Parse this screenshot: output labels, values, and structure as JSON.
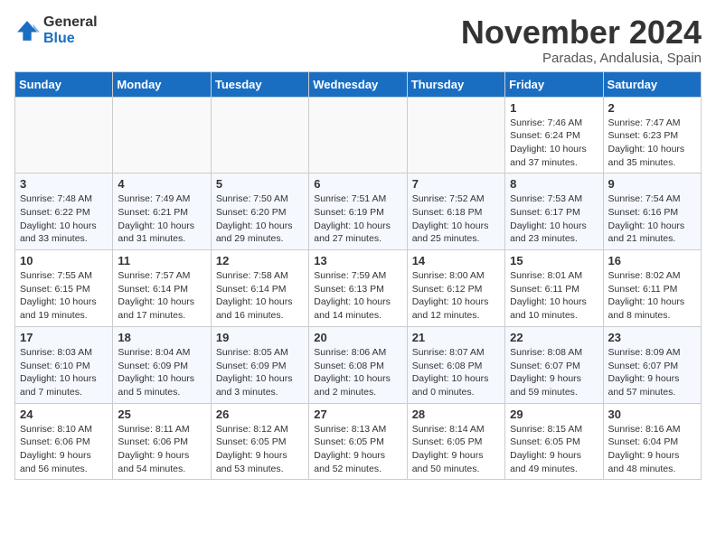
{
  "header": {
    "logo_general": "General",
    "logo_blue": "Blue",
    "month": "November 2024",
    "location": "Paradas, Andalusia, Spain"
  },
  "weekdays": [
    "Sunday",
    "Monday",
    "Tuesday",
    "Wednesday",
    "Thursday",
    "Friday",
    "Saturday"
  ],
  "weeks": [
    [
      {
        "day": "",
        "info": ""
      },
      {
        "day": "",
        "info": ""
      },
      {
        "day": "",
        "info": ""
      },
      {
        "day": "",
        "info": ""
      },
      {
        "day": "",
        "info": ""
      },
      {
        "day": "1",
        "info": "Sunrise: 7:46 AM\nSunset: 6:24 PM\nDaylight: 10 hours and 37 minutes."
      },
      {
        "day": "2",
        "info": "Sunrise: 7:47 AM\nSunset: 6:23 PM\nDaylight: 10 hours and 35 minutes."
      }
    ],
    [
      {
        "day": "3",
        "info": "Sunrise: 7:48 AM\nSunset: 6:22 PM\nDaylight: 10 hours and 33 minutes."
      },
      {
        "day": "4",
        "info": "Sunrise: 7:49 AM\nSunset: 6:21 PM\nDaylight: 10 hours and 31 minutes."
      },
      {
        "day": "5",
        "info": "Sunrise: 7:50 AM\nSunset: 6:20 PM\nDaylight: 10 hours and 29 minutes."
      },
      {
        "day": "6",
        "info": "Sunrise: 7:51 AM\nSunset: 6:19 PM\nDaylight: 10 hours and 27 minutes."
      },
      {
        "day": "7",
        "info": "Sunrise: 7:52 AM\nSunset: 6:18 PM\nDaylight: 10 hours and 25 minutes."
      },
      {
        "day": "8",
        "info": "Sunrise: 7:53 AM\nSunset: 6:17 PM\nDaylight: 10 hours and 23 minutes."
      },
      {
        "day": "9",
        "info": "Sunrise: 7:54 AM\nSunset: 6:16 PM\nDaylight: 10 hours and 21 minutes."
      }
    ],
    [
      {
        "day": "10",
        "info": "Sunrise: 7:55 AM\nSunset: 6:15 PM\nDaylight: 10 hours and 19 minutes."
      },
      {
        "day": "11",
        "info": "Sunrise: 7:57 AM\nSunset: 6:14 PM\nDaylight: 10 hours and 17 minutes."
      },
      {
        "day": "12",
        "info": "Sunrise: 7:58 AM\nSunset: 6:14 PM\nDaylight: 10 hours and 16 minutes."
      },
      {
        "day": "13",
        "info": "Sunrise: 7:59 AM\nSunset: 6:13 PM\nDaylight: 10 hours and 14 minutes."
      },
      {
        "day": "14",
        "info": "Sunrise: 8:00 AM\nSunset: 6:12 PM\nDaylight: 10 hours and 12 minutes."
      },
      {
        "day": "15",
        "info": "Sunrise: 8:01 AM\nSunset: 6:11 PM\nDaylight: 10 hours and 10 minutes."
      },
      {
        "day": "16",
        "info": "Sunrise: 8:02 AM\nSunset: 6:11 PM\nDaylight: 10 hours and 8 minutes."
      }
    ],
    [
      {
        "day": "17",
        "info": "Sunrise: 8:03 AM\nSunset: 6:10 PM\nDaylight: 10 hours and 7 minutes."
      },
      {
        "day": "18",
        "info": "Sunrise: 8:04 AM\nSunset: 6:09 PM\nDaylight: 10 hours and 5 minutes."
      },
      {
        "day": "19",
        "info": "Sunrise: 8:05 AM\nSunset: 6:09 PM\nDaylight: 10 hours and 3 minutes."
      },
      {
        "day": "20",
        "info": "Sunrise: 8:06 AM\nSunset: 6:08 PM\nDaylight: 10 hours and 2 minutes."
      },
      {
        "day": "21",
        "info": "Sunrise: 8:07 AM\nSunset: 6:08 PM\nDaylight: 10 hours and 0 minutes."
      },
      {
        "day": "22",
        "info": "Sunrise: 8:08 AM\nSunset: 6:07 PM\nDaylight: 9 hours and 59 minutes."
      },
      {
        "day": "23",
        "info": "Sunrise: 8:09 AM\nSunset: 6:07 PM\nDaylight: 9 hours and 57 minutes."
      }
    ],
    [
      {
        "day": "24",
        "info": "Sunrise: 8:10 AM\nSunset: 6:06 PM\nDaylight: 9 hours and 56 minutes."
      },
      {
        "day": "25",
        "info": "Sunrise: 8:11 AM\nSunset: 6:06 PM\nDaylight: 9 hours and 54 minutes."
      },
      {
        "day": "26",
        "info": "Sunrise: 8:12 AM\nSunset: 6:05 PM\nDaylight: 9 hours and 53 minutes."
      },
      {
        "day": "27",
        "info": "Sunrise: 8:13 AM\nSunset: 6:05 PM\nDaylight: 9 hours and 52 minutes."
      },
      {
        "day": "28",
        "info": "Sunrise: 8:14 AM\nSunset: 6:05 PM\nDaylight: 9 hours and 50 minutes."
      },
      {
        "day": "29",
        "info": "Sunrise: 8:15 AM\nSunset: 6:05 PM\nDaylight: 9 hours and 49 minutes."
      },
      {
        "day": "30",
        "info": "Sunrise: 8:16 AM\nSunset: 6:04 PM\nDaylight: 9 hours and 48 minutes."
      }
    ]
  ]
}
